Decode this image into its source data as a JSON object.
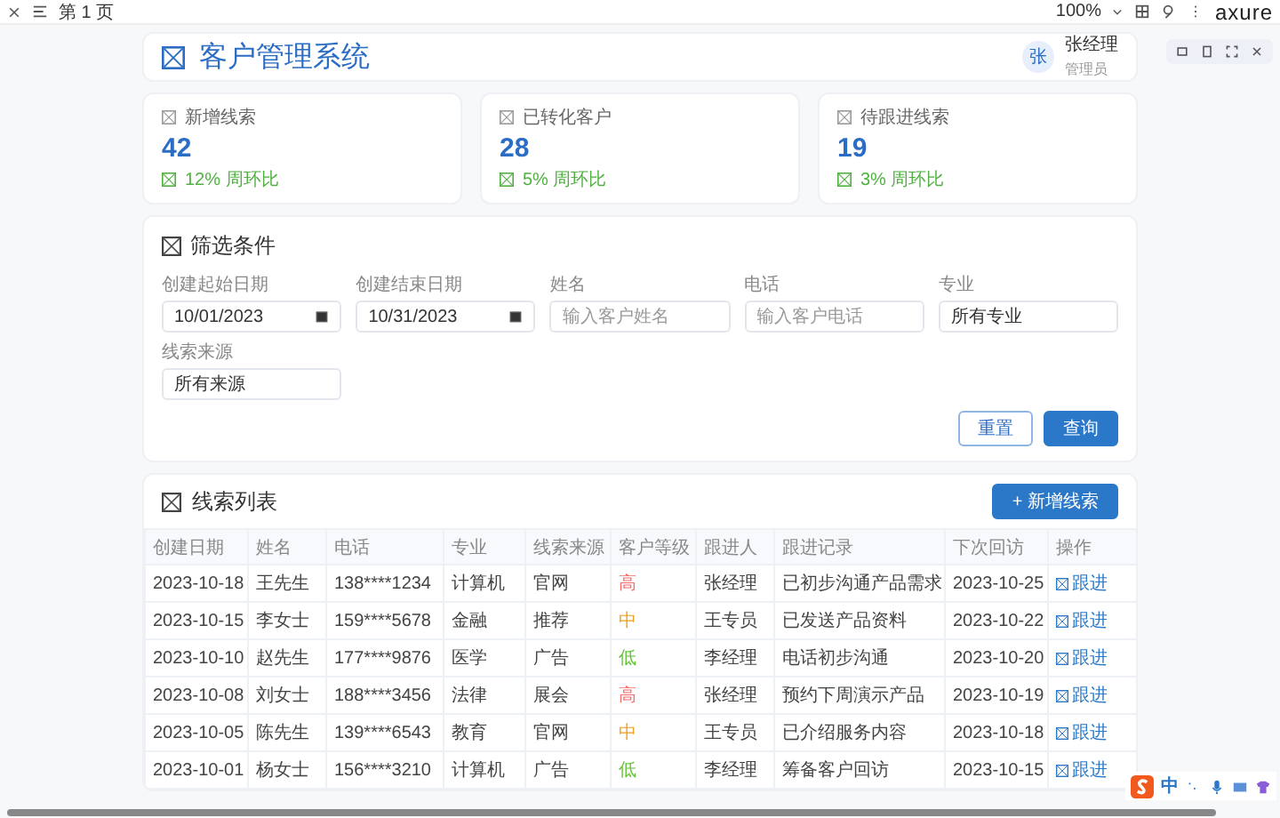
{
  "topbar": {
    "page_label": "第 1 页",
    "zoom": "100%",
    "brand": "axure"
  },
  "header": {
    "title": "客户管理系统",
    "user": {
      "avatar": "张",
      "name": "张经理",
      "role": "管理员"
    }
  },
  "stats": [
    {
      "label": "新增线索",
      "value": "42",
      "change": "12% 周环比"
    },
    {
      "label": "已转化客户",
      "value": "28",
      "change": "5% 周环比"
    },
    {
      "label": "待跟进线索",
      "value": "19",
      "change": "3% 周环比"
    }
  ],
  "filter": {
    "title": "筛选条件",
    "fields": [
      {
        "label": "创建起始日期",
        "kind": "date",
        "value": "10/01/2023"
      },
      {
        "label": "创建结束日期",
        "kind": "date",
        "value": "10/31/2023"
      },
      {
        "label": "姓名",
        "kind": "text",
        "placeholder": "输入客户姓名"
      },
      {
        "label": "电话",
        "kind": "text",
        "placeholder": "输入客户电话"
      },
      {
        "label": "专业",
        "kind": "select",
        "value": "所有专业"
      },
      {
        "label": "线索来源",
        "kind": "select",
        "value": "所有来源"
      }
    ],
    "buttons": [
      {
        "label": "重置",
        "kind": "secondary"
      },
      {
        "label": "查询",
        "kind": "primary"
      }
    ]
  },
  "leads": {
    "title": "线索列表",
    "add_button": "+ 新增线索",
    "columns": [
      "创建日期",
      "姓名",
      "电话",
      "专业",
      "线索来源",
      "客户等级",
      "跟进人",
      "跟进记录",
      "下次回访",
      "操作"
    ],
    "rows": [
      {
        "date": "2023-10-18",
        "name": "王先生",
        "phone": "138****1234",
        "major": "计算机",
        "source": "官网",
        "level": "高",
        "color": "#f56c6c",
        "owner": "张经理",
        "record": "已初步沟通产品需求",
        "next": "2023-10-25",
        "action": "跟进"
      },
      {
        "date": "2023-10-15",
        "name": "李女士",
        "phone": "159****5678",
        "major": "金融",
        "source": "推荐",
        "level": "中",
        "color": "#f0a020",
        "owner": "王专员",
        "record": "已发送产品资料",
        "next": "2023-10-22",
        "action": "跟进"
      },
      {
        "date": "2023-10-10",
        "name": "赵先生",
        "phone": "177****9876",
        "major": "医学",
        "source": "广告",
        "level": "低",
        "color": "#67c23a",
        "owner": "李经理",
        "record": "电话初步沟通",
        "next": "2023-10-20",
        "action": "跟进"
      },
      {
        "date": "2023-10-08",
        "name": "刘女士",
        "phone": "188****3456",
        "major": "法律",
        "source": "展会",
        "level": "高",
        "color": "#f56c6c",
        "owner": "张经理",
        "record": "预约下周演示产品",
        "next": "2023-10-19",
        "action": "跟进"
      },
      {
        "date": "2023-10-05",
        "name": "陈先生",
        "phone": "139****6543",
        "major": "教育",
        "source": "官网",
        "level": "中",
        "color": "#f0a020",
        "owner": "王专员",
        "record": "已介绍服务内容",
        "next": "2023-10-18",
        "action": "跟进"
      },
      {
        "date": "2023-10-01",
        "name": "杨女士",
        "phone": "156****3210",
        "major": "计算机",
        "source": "广告",
        "level": "低",
        "color": "#67c23a",
        "owner": "李经理",
        "record": "筹备客户回访",
        "next": "2023-10-15",
        "action": "跟进"
      }
    ]
  },
  "ime": {
    "mode": "中"
  }
}
